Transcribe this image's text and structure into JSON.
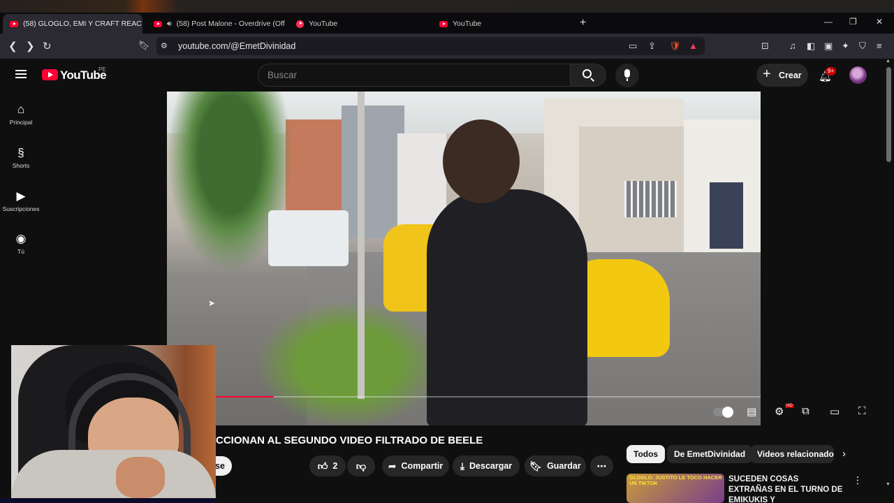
{
  "browser": {
    "tabs": [
      {
        "title": "(58) GLOGLO, EMI Y CRAFT REAC",
        "active": true
      },
      {
        "title": "(58) Post Malone - Overdrive (Off",
        "active": false
      },
      {
        "title": "YouTube",
        "active": false
      },
      {
        "title": "YouTube",
        "active": false
      }
    ],
    "tab_close": "✕",
    "new_tab": "+",
    "url": "youtube.com/@EmetDivinidad"
  },
  "youtube": {
    "logo_text": "YouTube",
    "region": "PE",
    "search_placeholder": "Buscar",
    "create_label": "Crear",
    "notification_badge": "9+",
    "sidebar": [
      {
        "label": "Principal",
        "icon": "home-icon"
      },
      {
        "label": "Shorts",
        "icon": "shorts-icon"
      },
      {
        "label": "Suscripciones",
        "icon": "subscriptions-icon"
      },
      {
        "label": "Tú",
        "icon": "you-icon"
      }
    ],
    "video": {
      "title": "CCIONAN AL SEGUNDO VIDEO FILTRADO DE BEELE",
      "progress": 0.18
    },
    "actions": {
      "subscribe_fragment": "se",
      "likes": "2",
      "share": "Compartir",
      "download": "Descargar",
      "save": "Guardar"
    },
    "chips": [
      "Todos",
      "De EmetDivinidad",
      "Videos relacionados"
    ],
    "recommended": {
      "thumb_text": "GLOGLO: JUSTITO LE TOCO HACER UN TIKTOK",
      "title": "SUCEDEN COSAS EXTRAÑAS EN EL TURNO DE EMIKUKIS Y"
    },
    "colors": {
      "brand": "#ff0033",
      "background": "#0f0f0f"
    }
  }
}
